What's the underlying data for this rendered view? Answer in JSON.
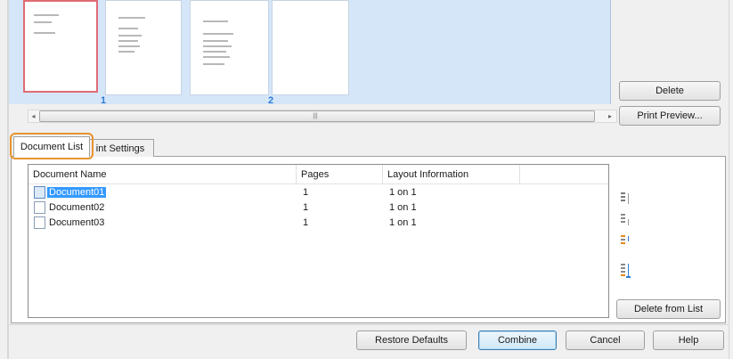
{
  "preview": {
    "page_numbers": [
      "1",
      "2"
    ]
  },
  "buttons": {
    "delete": "Delete",
    "print_preview": "Print Preview...",
    "delete_from_list": "Delete from List",
    "restore_defaults": "Restore Defaults",
    "combine": "Combine",
    "cancel": "Cancel",
    "help": "Help"
  },
  "tabs": [
    {
      "label": "Document List",
      "active": true
    },
    {
      "label": "int Settings",
      "active": false
    }
  ],
  "list": {
    "columns": [
      "Document Name",
      "Pages",
      "Layout Information"
    ],
    "rows": [
      {
        "name": "Document01",
        "pages": "1",
        "layout": "1 on 1",
        "selected": true
      },
      {
        "name": "Document02",
        "pages": "1",
        "layout": "1 on 1",
        "selected": false
      },
      {
        "name": "Document03",
        "pages": "1",
        "layout": "1 on 1",
        "selected": false
      }
    ]
  },
  "icons": {
    "move_top": "move-to-top-icon",
    "move_up": "move-up-icon",
    "move_down": "move-down-icon",
    "move_bottom": "move-to-bottom-icon"
  },
  "colors": {
    "selection": "#3399ff",
    "highlight_ring": "#e8922e",
    "page_number": "#2c7bd4",
    "selected_page_border": "#e06b74",
    "preview_bg": "#d6e6f9"
  }
}
